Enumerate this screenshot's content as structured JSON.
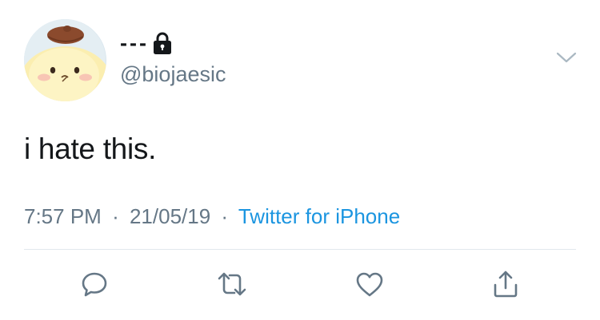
{
  "author": {
    "display_name": "---",
    "handle": "@biojaesic",
    "protected": true
  },
  "tweet": {
    "text": "i hate this.",
    "time": "7:57 PM",
    "date": "21/05/19",
    "separator": "·",
    "source": "Twitter for iPhone"
  },
  "icons": {
    "lock": "lock-icon",
    "menu": "chevron-down-icon",
    "reply": "reply-icon",
    "retweet": "retweet-icon",
    "like": "heart-icon",
    "share": "share-icon"
  },
  "colors": {
    "text": "#14171a",
    "muted": "#657786",
    "link": "#1b95e0",
    "icon": "#657786",
    "divider": "#e1e8ed"
  }
}
